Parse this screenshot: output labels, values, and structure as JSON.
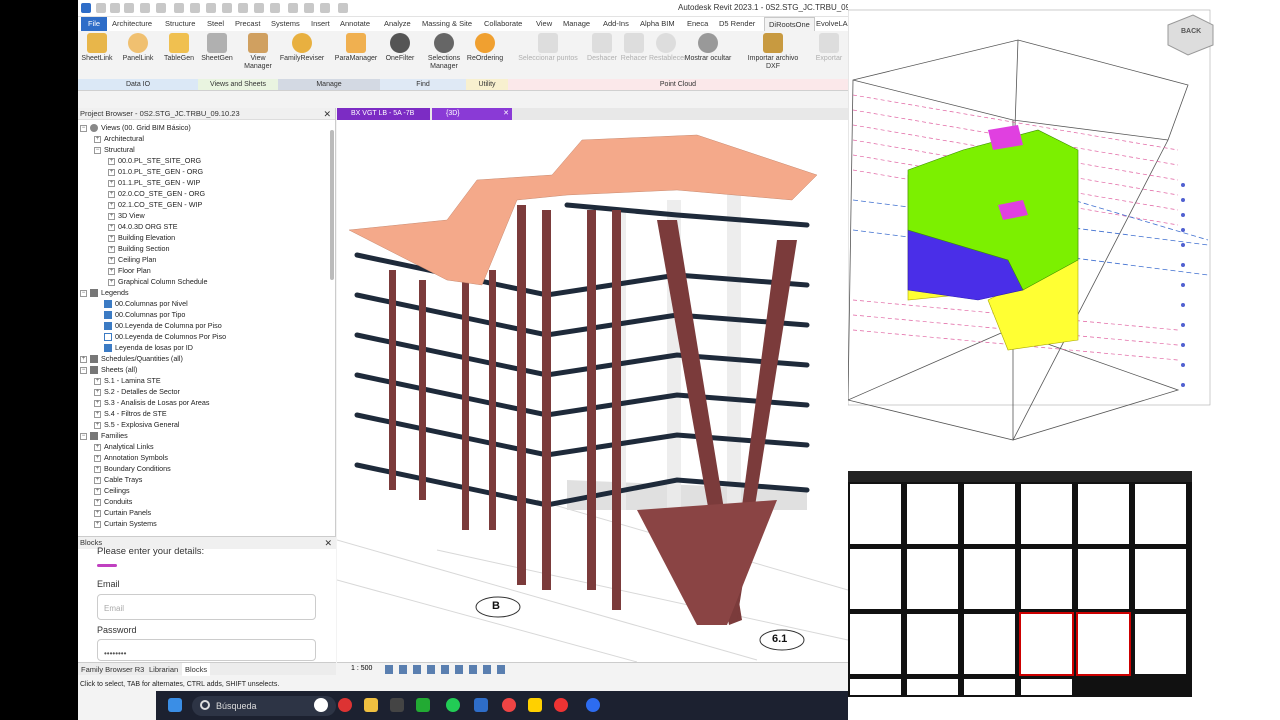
{
  "app": {
    "title": "Autodesk Revit 2023.1 - 0S2.STG_JC.TRBU_09.10.23"
  },
  "tabs": [
    {
      "label": "File"
    },
    {
      "label": "Architecture"
    },
    {
      "label": "Structure"
    },
    {
      "label": "Steel"
    },
    {
      "label": "Precast"
    },
    {
      "label": "Systems"
    },
    {
      "label": "Insert"
    },
    {
      "label": "Annotate"
    },
    {
      "label": "Analyze"
    },
    {
      "label": "Massing & Site"
    },
    {
      "label": "Collaborate"
    },
    {
      "label": "View"
    },
    {
      "label": "Manage"
    },
    {
      "label": "Add-Ins"
    },
    {
      "label": "Alpha BIM"
    },
    {
      "label": "Eneca"
    },
    {
      "label": "D5 Render"
    },
    {
      "label": "DiRootsOne"
    },
    {
      "label": "EvolveLA"
    }
  ],
  "ribbon": {
    "buttons": [
      {
        "label": "SheetLink"
      },
      {
        "label": "PanelLink"
      },
      {
        "label": "TableGen"
      },
      {
        "label": "SheetGen"
      },
      {
        "label": "View Manager"
      },
      {
        "label": "FamilyReviser"
      },
      {
        "label": "ParaManager"
      },
      {
        "label": "OneFilter"
      },
      {
        "label": "Selections Manager"
      },
      {
        "label": "ReOrdering"
      },
      {
        "label": "Seleccionar puntos"
      },
      {
        "label": "Deshacer"
      },
      {
        "label": "Rehacer"
      },
      {
        "label": "Restablecer"
      },
      {
        "label": "Mostrar ocultar"
      },
      {
        "label": "Importar archivo DXF"
      },
      {
        "label": "Exportar"
      }
    ],
    "panels": [
      {
        "label": "Data IO"
      },
      {
        "label": "Views and Sheets"
      },
      {
        "label": "Manage"
      },
      {
        "label": "Find"
      },
      {
        "label": "Utility"
      },
      {
        "label": "Point Cloud"
      }
    ]
  },
  "project_browser": {
    "title": "Project Browser - 0S2.STG_JC.TRBU_09.10.23",
    "items": [
      {
        "label": "Views (00. Grid BIM Básico)"
      },
      {
        "label": "Architectural"
      },
      {
        "label": "Structural"
      },
      {
        "label": "00.0.PL_STE_SITE_ORG"
      },
      {
        "label": "01.0.PL_STE_GEN - ORG"
      },
      {
        "label": "01.1.PL_STE_GEN - WIP"
      },
      {
        "label": "02.0.CO_STE_GEN - ORG"
      },
      {
        "label": "02.1.CO_STE_GEN - WIP"
      },
      {
        "label": "3D View"
      },
      {
        "label": "04.0.3D ORG STE"
      },
      {
        "label": "Building Elevation"
      },
      {
        "label": "Building Section"
      },
      {
        "label": "Ceiling Plan"
      },
      {
        "label": "Floor Plan"
      },
      {
        "label": "Graphical Column Schedule"
      },
      {
        "label": "Legends"
      },
      {
        "label": "00.Columnas por Nivel"
      },
      {
        "label": "00.Columnas por Tipo"
      },
      {
        "label": "00.Leyenda de Columna por Piso"
      },
      {
        "label": "00.Leyenda de Columnos Por Piso"
      },
      {
        "label": "Leyenda de losas por ID"
      },
      {
        "label": "Schedules/Quantities (all)"
      },
      {
        "label": "Sheets (all)"
      },
      {
        "label": "S.1 - Lamina STE"
      },
      {
        "label": "S.2 - Detalles de Sector"
      },
      {
        "label": "S.3 - Analisis de Losas por Areas"
      },
      {
        "label": "S.4 - Filtros de STE"
      },
      {
        "label": "S.5 - Explosiva General"
      },
      {
        "label": "Families"
      },
      {
        "label": "Analytical Links"
      },
      {
        "label": "Annotation Symbols"
      },
      {
        "label": "Boundary Conditions"
      },
      {
        "label": "Cable Trays"
      },
      {
        "label": "Ceilings"
      },
      {
        "label": "Conduits"
      },
      {
        "label": "Curtain Panels"
      },
      {
        "label": "Curtain Systems"
      }
    ]
  },
  "blocks": {
    "title": "Blocks",
    "prompt": "Please enter your details:",
    "email_label": "Email",
    "email_placeholder": "Email",
    "password_label": "Password",
    "password_value": "••••••••"
  },
  "browser_tabs": [
    {
      "label": "Family Browser R3"
    },
    {
      "label": "Librarian"
    },
    {
      "label": "Blocks"
    }
  ],
  "view_tabs": [
    {
      "label": "BX VGT LB - 5A -7B"
    },
    {
      "label": "{3D}"
    }
  ],
  "viewport": {
    "grid_b": "B",
    "grid_61": "6.1",
    "scale": "1 : 500"
  },
  "status": {
    "text": "Click to select, TAB for alternates, CTRL adds, SHIFT unselects."
  },
  "viewcube": {
    "label": "BACK"
  },
  "taskbar": {
    "search": "Búsqueda"
  },
  "colors": {
    "accent_tab": "#7c2cc4",
    "file_tab": "#2e6dc8",
    "roof": "#f4a98a",
    "column": "#7b3b3b",
    "slab_edge": "#1e2a3a",
    "mass_green": "#7cf000",
    "mass_blue": "#4a2ee8",
    "mass_yellow": "#ffff33",
    "mass_pink": "#e040e0"
  }
}
